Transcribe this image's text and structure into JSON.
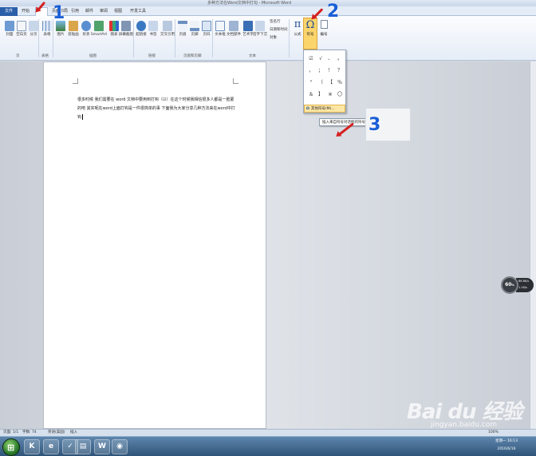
{
  "window": {
    "title": "多种方法在Word文档中打勾 - Microsoft Word"
  },
  "tabs": [
    "文件",
    "开始",
    "插入",
    "页面布局",
    "引用",
    "邮件",
    "审阅",
    "视图",
    "开发工具"
  ],
  "ribbon": {
    "buttons": [
      "封面",
      "空白页",
      "分页",
      "表格",
      "图片",
      "剪贴画",
      "形状",
      "SmartArt",
      "图表",
      "屏幕截图",
      "超链接",
      "书签",
      "交叉引用",
      "页眉",
      "页脚",
      "页码",
      "文本框",
      "文档部件",
      "艺术字",
      "首字下沉"
    ],
    "small_cmds": [
      "签名行",
      "日期和时间",
      "对象"
    ],
    "groups": [
      "页",
      "表格",
      "插图",
      "链接",
      "页眉和页脚",
      "文本"
    ],
    "pi_label": "公式",
    "symbol_label": "符号",
    "number_label": "编号"
  },
  "symbols": {
    "grid": [
      "☑",
      "√",
      "、",
      "。",
      "，",
      "；",
      "！",
      "？",
      "“",
      "（",
      "【",
      "％",
      "＆",
      "】",
      "※",
      "〇"
    ],
    "more_label": "其他符号(M)..."
  },
  "tooltip": "插入来自符号对话框的符号",
  "annotations": [
    "1",
    "2",
    "3"
  ],
  "document": {
    "line1": "很多时候 我们需要在 word 文档中要用到打钩（☑）在这个时候我相信很多人都是一脸蒙",
    "line2": "的吧 其实呢在word上面打钩是一件很简单的事 下面我为大家分享几种方法来在word中打",
    "line3": "钩"
  },
  "gauge": {
    "percent": "60",
    "unit": "%",
    "stat1": "66.8K/s",
    "stat2": "1.1K/s"
  },
  "status": {
    "page": "页面: 1/1",
    "words": "字数: 74",
    "lang": "英语(美国)",
    "mode": "插入",
    "zoom": "100%"
  },
  "taskbar": {
    "time": "星期一 16:13",
    "date": "2016/6/16"
  },
  "watermark": {
    "brand": "Bai du 经验",
    "url": "jingyan.baidu.com"
  }
}
